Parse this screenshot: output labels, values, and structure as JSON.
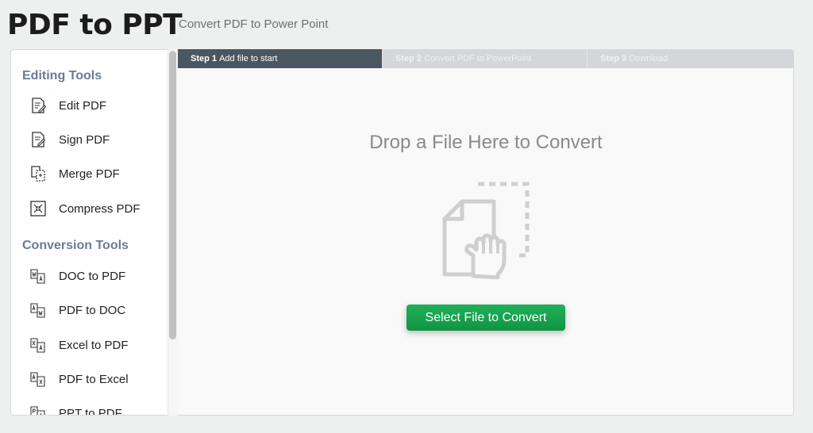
{
  "header": {
    "title": "PDF to PPT",
    "subtitle": "Convert PDF to Power Point"
  },
  "sidebar": {
    "sections": [
      {
        "heading": "Editing Tools",
        "items": [
          {
            "label": "Edit PDF",
            "icon": "edit-pdf-icon"
          },
          {
            "label": "Sign PDF",
            "icon": "sign-pdf-icon"
          },
          {
            "label": "Merge PDF",
            "icon": "merge-pdf-icon"
          },
          {
            "label": "Compress PDF",
            "icon": "compress-pdf-icon"
          }
        ]
      },
      {
        "heading": "Conversion Tools",
        "items": [
          {
            "label": "DOC to PDF",
            "icon": "doc-to-pdf-icon"
          },
          {
            "label": "PDF to DOC",
            "icon": "pdf-to-doc-icon"
          },
          {
            "label": "Excel to PDF",
            "icon": "excel-to-pdf-icon"
          },
          {
            "label": "PDF to Excel",
            "icon": "pdf-to-excel-icon"
          },
          {
            "label": "PPT to PDF",
            "icon": "ppt-to-pdf-icon"
          }
        ]
      }
    ]
  },
  "steps": [
    {
      "number": "Step 1",
      "text": "Add file to start",
      "active": true
    },
    {
      "number": "Step 2",
      "text": "Convert PDF to PowerPoint",
      "active": false
    },
    {
      "number": "Step 3",
      "text": "Download",
      "active": false
    }
  ],
  "dropzone": {
    "title": "Drop a File Here to Convert",
    "button_label": "Select File to Convert"
  },
  "colors": {
    "accent_green": "#1aa34e",
    "active_step": "#4a5761",
    "heading_slate": "#6b7a95"
  }
}
